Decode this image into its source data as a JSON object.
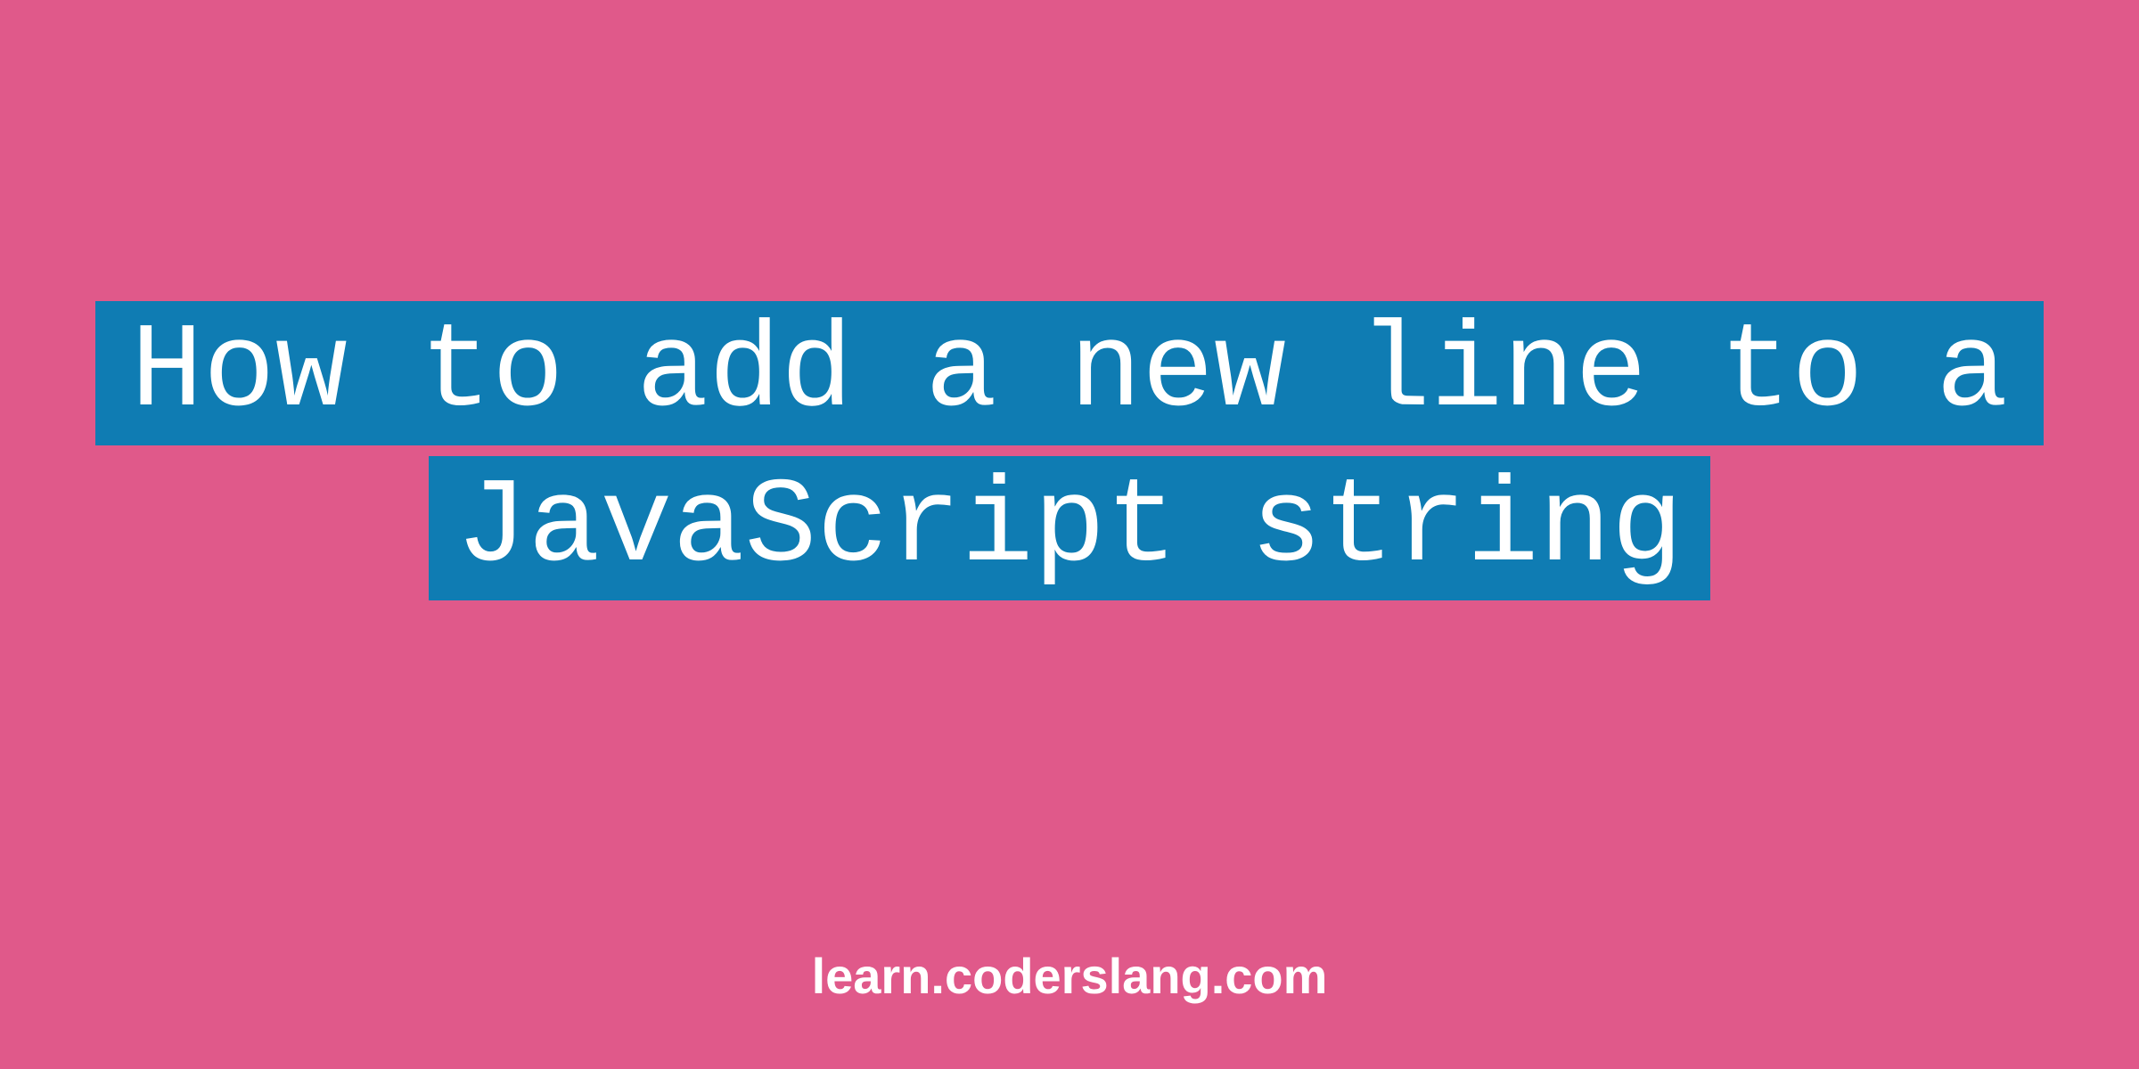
{
  "title": {
    "line1": "How to add a new line to a",
    "line2": "JavaScript string"
  },
  "footer": "learn.coderslang.com",
  "colors": {
    "background": "#e0598a",
    "highlight": "#0f7cb3",
    "text": "#ffffff"
  }
}
